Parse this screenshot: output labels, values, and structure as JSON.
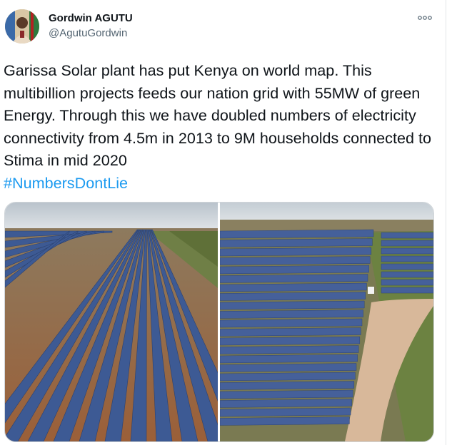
{
  "tweet": {
    "author_name": "Gordwin AGUTU",
    "author_handle": "@AgutuGordwin",
    "text": "Garissa Solar plant has put Kenya on world map. This multibillion projects feeds our nation grid with 55MW of green Energy. Through this we have doubled numbers of electricity connectivity from 4.5m in 2013 to 9M households connected to Stima in mid 2020",
    "hashtag": "#NumbersDontLie",
    "more_icon": "more-horizontal-icon"
  },
  "media": {
    "photos": [
      {
        "subject": "aerial-solar-panel-rows"
      },
      {
        "subject": "aerial-solar-farm-with-dirt-road"
      }
    ]
  },
  "colors": {
    "text": "#0f1419",
    "secondary": "#536471",
    "link": "#1d9bf0",
    "panel": "#3f5a8e",
    "soil": "#9a6a45",
    "sky": "#cfd6dc"
  }
}
